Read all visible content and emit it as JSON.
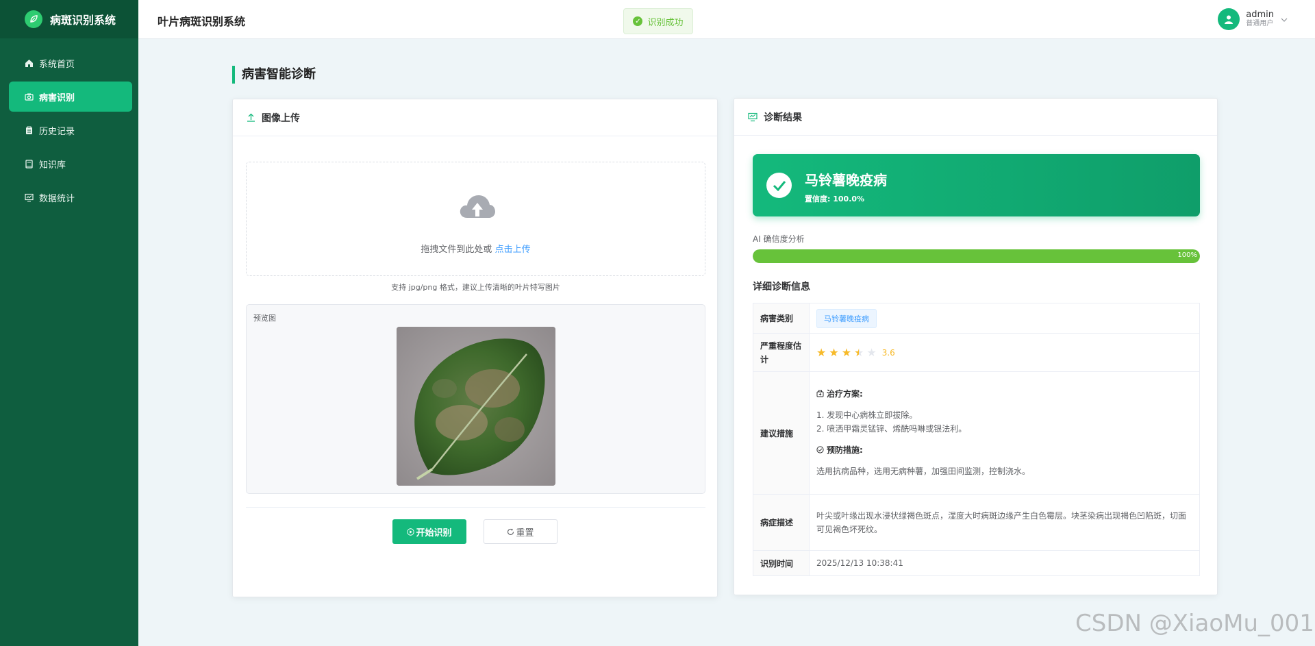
{
  "sidebar": {
    "brand": "病斑识别系统",
    "items": [
      {
        "label": "系统首页",
        "icon": "home-icon"
      },
      {
        "label": "病害识别",
        "icon": "camera-icon"
      },
      {
        "label": "历史记录",
        "icon": "clipboard-icon"
      },
      {
        "label": "知识库",
        "icon": "book-icon"
      },
      {
        "label": "数据统计",
        "icon": "chart-icon"
      }
    ],
    "active_index": 1
  },
  "header": {
    "title": "叶片病斑识别系统",
    "toast": "识别成功",
    "user": {
      "name": "admin",
      "role": "普通用户"
    }
  },
  "page": {
    "title": "病害智能诊断"
  },
  "upload": {
    "title": "图像上传",
    "drop_text": "拖拽文件到此处或",
    "drop_link": "点击上传",
    "hint": "支持 jpg/png 格式，建议上传清晰的叶片特写图片",
    "preview_label": "预览图",
    "start_button": "开始识别",
    "reset_button": "重置"
  },
  "result": {
    "title": "诊断结果",
    "disease": "马铃薯晚疫病",
    "confidence_text": "置信度: 100.0%",
    "confidence_label": "AI 确信度分析",
    "confidence_value": 100,
    "confidence_pct": "100%",
    "detail_title": "详细诊断信息",
    "rows": {
      "category_label": "病害类别",
      "category_value": "马铃薯晚疫病",
      "severity_label": "严重程度估计",
      "severity_value": 3.6,
      "severity_text": "3.6",
      "advice_label": "建议措施",
      "treatment_title": "治疗方案:",
      "treatment_1": "1. 发现中心病株立即拔除。",
      "treatment_2": "2. 喷洒甲霜灵锰锌、烯酰吗啉或银法利。",
      "prevention_title": "预防措施:",
      "prevention_text": "选用抗病品种，选用无病种薯，加强田间监测，控制浇水。",
      "symptom_label": "病症描述",
      "symptom_text": "叶尖或叶缘出现水浸状绿褐色斑点，湿度大时病斑边缘产生白色霉层。块茎染病出现褐色凹陷斑，切面可见褐色坏死纹。",
      "time_label": "识别时间",
      "time_value": "2025/12/13 10:38:41"
    }
  },
  "colors": {
    "primary": "#14b97c",
    "sidebar": "#0f5e3f",
    "success": "#67c23a",
    "link": "#409eff",
    "star": "#f7ba2a"
  },
  "watermark": "CSDN @XiaoMu_001"
}
